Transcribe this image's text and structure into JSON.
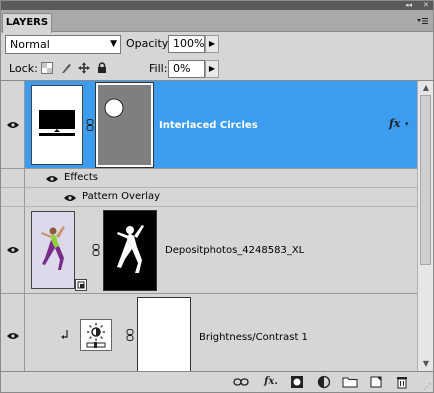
{
  "panel": {
    "tab_label": "LAYERS",
    "window_buttons": [
      "◂◂",
      "✕"
    ],
    "menu_icon": "panel-menu-icon"
  },
  "options": {
    "blend_mode": "Normal",
    "opacity_label": "Opacity:",
    "opacity_value": "100%",
    "lock_label": "Lock:",
    "fill_label": "Fill:",
    "fill_value": "0%"
  },
  "layers": [
    {
      "name": "Interlaced Circles",
      "selected": true,
      "visible": true,
      "has_fx": true,
      "fx_label": "fx",
      "effects_label": "Effects",
      "effects": [
        "Pattern Overlay"
      ]
    },
    {
      "name": "Depositphotos_4248583_XL",
      "selected": false,
      "visible": true
    },
    {
      "name": "Brightness/Contrast 1",
      "selected": false,
      "visible": true,
      "clipped": true
    }
  ],
  "colors": {
    "selected_row": "#3b9cf0",
    "panel_bg": "#d6d6d6",
    "title_bar": "#5a5a5a",
    "mask_gray": "#7f7f7f"
  },
  "footer_icons": [
    "link-layers-icon",
    "fx-icon",
    "add-mask-icon",
    "adjustment-layer-icon",
    "group-icon",
    "new-layer-icon",
    "delete-icon"
  ]
}
